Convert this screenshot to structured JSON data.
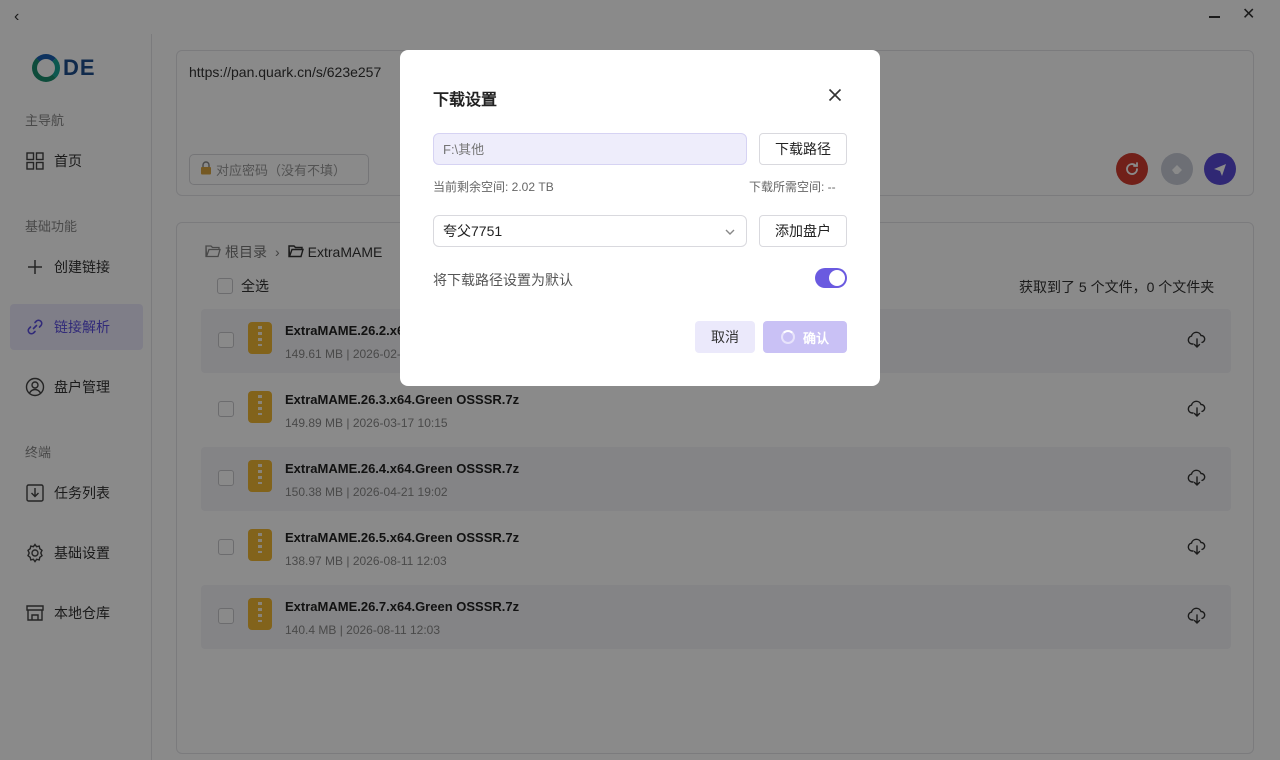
{
  "logo": {
    "text": "DE"
  },
  "sidebar": {
    "sections": [
      "主导航",
      "基础功能",
      "终端"
    ],
    "items": [
      {
        "label": "首页",
        "icon": "grid-icon"
      },
      {
        "label": "创建链接",
        "icon": "plus-icon"
      },
      {
        "label": "链接解析",
        "icon": "link-icon",
        "active": true
      },
      {
        "label": "盘户管理",
        "icon": "user-icon"
      },
      {
        "label": "任务列表",
        "icon": "download-box-icon"
      },
      {
        "label": "基础设置",
        "icon": "gear-icon"
      },
      {
        "label": "本地仓库",
        "icon": "store-icon"
      }
    ]
  },
  "link_input": {
    "url": "https://pan.quark.cn/s/623e257",
    "password_placeholder": "对应密码（没有不填）"
  },
  "breadcrumb": {
    "root": "根目录",
    "current": "ExtraMAME"
  },
  "file_list": {
    "select_all": "全选",
    "summary": "获取到了 5 个文件，0 个文件夹",
    "files": [
      {
        "name": "ExtraMAME.26.2.x64",
        "meta": "149.61 MB | 2026-02-1"
      },
      {
        "name": "ExtraMAME.26.3.x64.Green OSSSR.7z",
        "meta": "149.89 MB | 2026-03-17 10:15"
      },
      {
        "name": "ExtraMAME.26.4.x64.Green OSSSR.7z",
        "meta": "150.38 MB | 2026-04-21 19:02"
      },
      {
        "name": "ExtraMAME.26.5.x64.Green OSSSR.7z",
        "meta": "138.97 MB | 2026-08-11 12:03"
      },
      {
        "name": "ExtraMAME.26.7.x64.Green OSSSR.7z",
        "meta": "140.4 MB | 2026-08-11 12:03"
      }
    ]
  },
  "dialog": {
    "title": "下载设置",
    "path_placeholder": "F:\\其他",
    "path_button": "下载路径",
    "free_space": "当前剩余空间:  2.02 TB",
    "required_space": "下载所需空间:  --",
    "account": "夸父7751",
    "add_account_button": "添加盘户",
    "default_label": "将下载路径设置为默认",
    "default_toggle_on": true,
    "cancel": "取消",
    "confirm": "确认"
  },
  "colors": {
    "accent": "#6a5ae0",
    "accent_light": "#ebe9fb",
    "refresh_button": "#d13b2f",
    "send_button": "#5a4bd6"
  }
}
